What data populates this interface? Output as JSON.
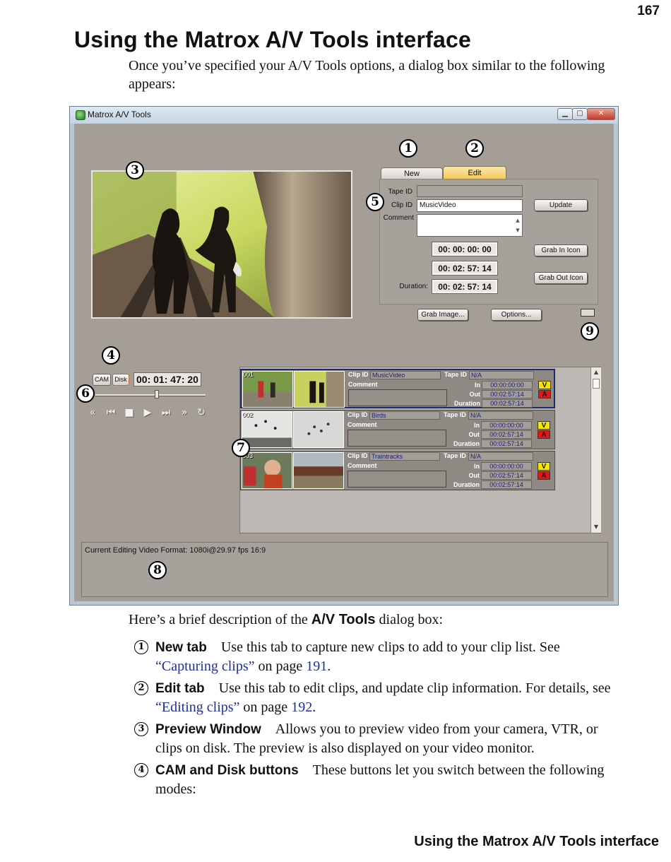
{
  "page": {
    "number": "167",
    "title": "Using the Matrox A/V Tools interface",
    "intro": "Once you’ve specified your A/V Tools options, a dialog box similar to the following appears:",
    "footer": "Using the Matrox A/V Tools interface"
  },
  "window": {
    "title": "Matrox A/V Tools",
    "controls": {
      "minimize": "▁",
      "maximize": "▢",
      "close": "✕"
    }
  },
  "tabs": {
    "new": "New",
    "edit": "Edit"
  },
  "edit_panel": {
    "tape_id_label": "Tape ID",
    "tape_id_value": "",
    "clip_id_label": "Clip ID",
    "clip_id_value": "MusicVideo",
    "comment_label": "Comment",
    "comment_value": "",
    "timecode_in": "00: 00: 00: 00",
    "timecode_out": "00: 02: 57: 14",
    "duration_label": "Duration:",
    "duration": "00: 02: 57: 14",
    "update_button": "Update",
    "grab_in_icon_button": "Grab In Icon",
    "grab_out_icon_button": "Grab Out Icon"
  },
  "bottom_buttons": {
    "grab_image": "Grab Image...",
    "options": "Options..."
  },
  "transport": {
    "cam": "CAM",
    "disk": "Disk",
    "timecode": "00: 01: 47: 20",
    "icons": {
      "rewind": "«",
      "prev": "⏮",
      "stop": "■",
      "play": "▶",
      "next": "⏭",
      "ffwd": "»",
      "loop": "↻"
    },
    "position_fraction": 0.56
  },
  "clips": [
    {
      "num": "001",
      "clip_id": "MusicVideo",
      "tape_id": "N/A",
      "in": "00:00:00:00",
      "out": "00:02:57:14",
      "duration": "00:02:57:14",
      "selected": true
    },
    {
      "num": "002",
      "clip_id": "Birds",
      "tape_id": "N/A",
      "in": "00:00:00:00",
      "out": "00:02:57:14",
      "duration": "00:02:57:14",
      "selected": false
    },
    {
      "num": "003",
      "clip_id": "Traintracks",
      "tape_id": "N/A",
      "in": "00:00:00:00",
      "out": "00:02:57:14",
      "duration": "00:02:57:14",
      "selected": false
    }
  ],
  "clip_labels": {
    "clip_id": "Clip ID",
    "tape_id": "Tape ID",
    "comment": "Comment",
    "in": "In",
    "out": "Out",
    "duration": "Duration",
    "video_badge": "V",
    "audio_badge": "A"
  },
  "status": {
    "text": "Current Editing Video Format: 1080i@29.97 fps 16:9"
  },
  "callouts": [
    "1",
    "2",
    "3",
    "4",
    "5",
    "6",
    "7",
    "8",
    "9"
  ],
  "description": {
    "intro_prefix": "Here’s a brief description of the ",
    "intro_bold": "A/V Tools",
    "intro_suffix": " dialog box:",
    "items": [
      {
        "num": "1",
        "term": "New tab",
        "text": "Use this tab to capture new clips to add to your clip list. See ",
        "link": "“Capturing clips”",
        "after": " on page ",
        "page": "191",
        "end": "."
      },
      {
        "num": "2",
        "term": "Edit tab",
        "text": "Use this tab to edit clips, and update clip information. For details, see ",
        "link": "“Editing clips”",
        "after": " on page ",
        "page": "192",
        "end": "."
      },
      {
        "num": "3",
        "term": "Preview Window",
        "text": "Allows you to preview video from your camera, VTR, or clips on disk. The preview is also displayed on your video monitor."
      },
      {
        "num": "4",
        "term": "CAM and Disk buttons",
        "text": "These buttons let you switch between the following modes:"
      }
    ]
  }
}
